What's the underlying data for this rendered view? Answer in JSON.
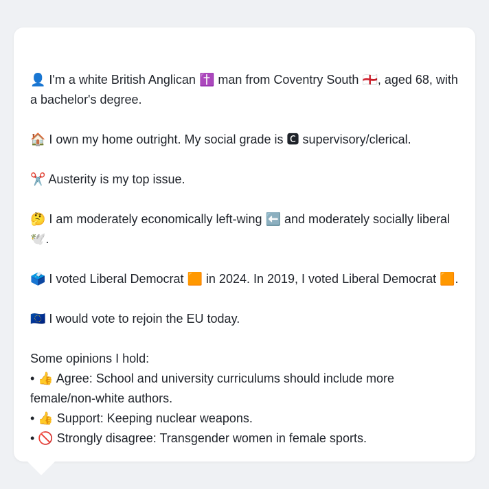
{
  "profile": {
    "identity": "👤 I'm a white British Anglican ✝️ man from Coventry South 🏴󠁧󠁢󠁥󠁮󠁧󠁿, aged 68, with a bachelor's degree.",
    "housing": "🏠 I own my home outright. My social grade is 🅲 supervisory/clerical.",
    "top_issue": "✂️ Austerity is my top issue.",
    "ideology": "🤔 I am moderately economically left-wing ⬅️ and moderately socially liberal 🕊️.",
    "votes": "🗳️ I voted Liberal Democrat 🟧 in 2024. In 2019, I voted Liberal Democrat 🟧.",
    "eu": "🇪🇺 I would vote to rejoin the EU today."
  },
  "opinions": {
    "heading": "Some opinions I hold:",
    "items": [
      "• 👍 Agree: School and university curriculums should include more female/non-white authors.",
      "• 👍 Support: Keeping nuclear weapons.",
      "• 🚫 Strongly disagree: Transgender women in female sports."
    ]
  }
}
